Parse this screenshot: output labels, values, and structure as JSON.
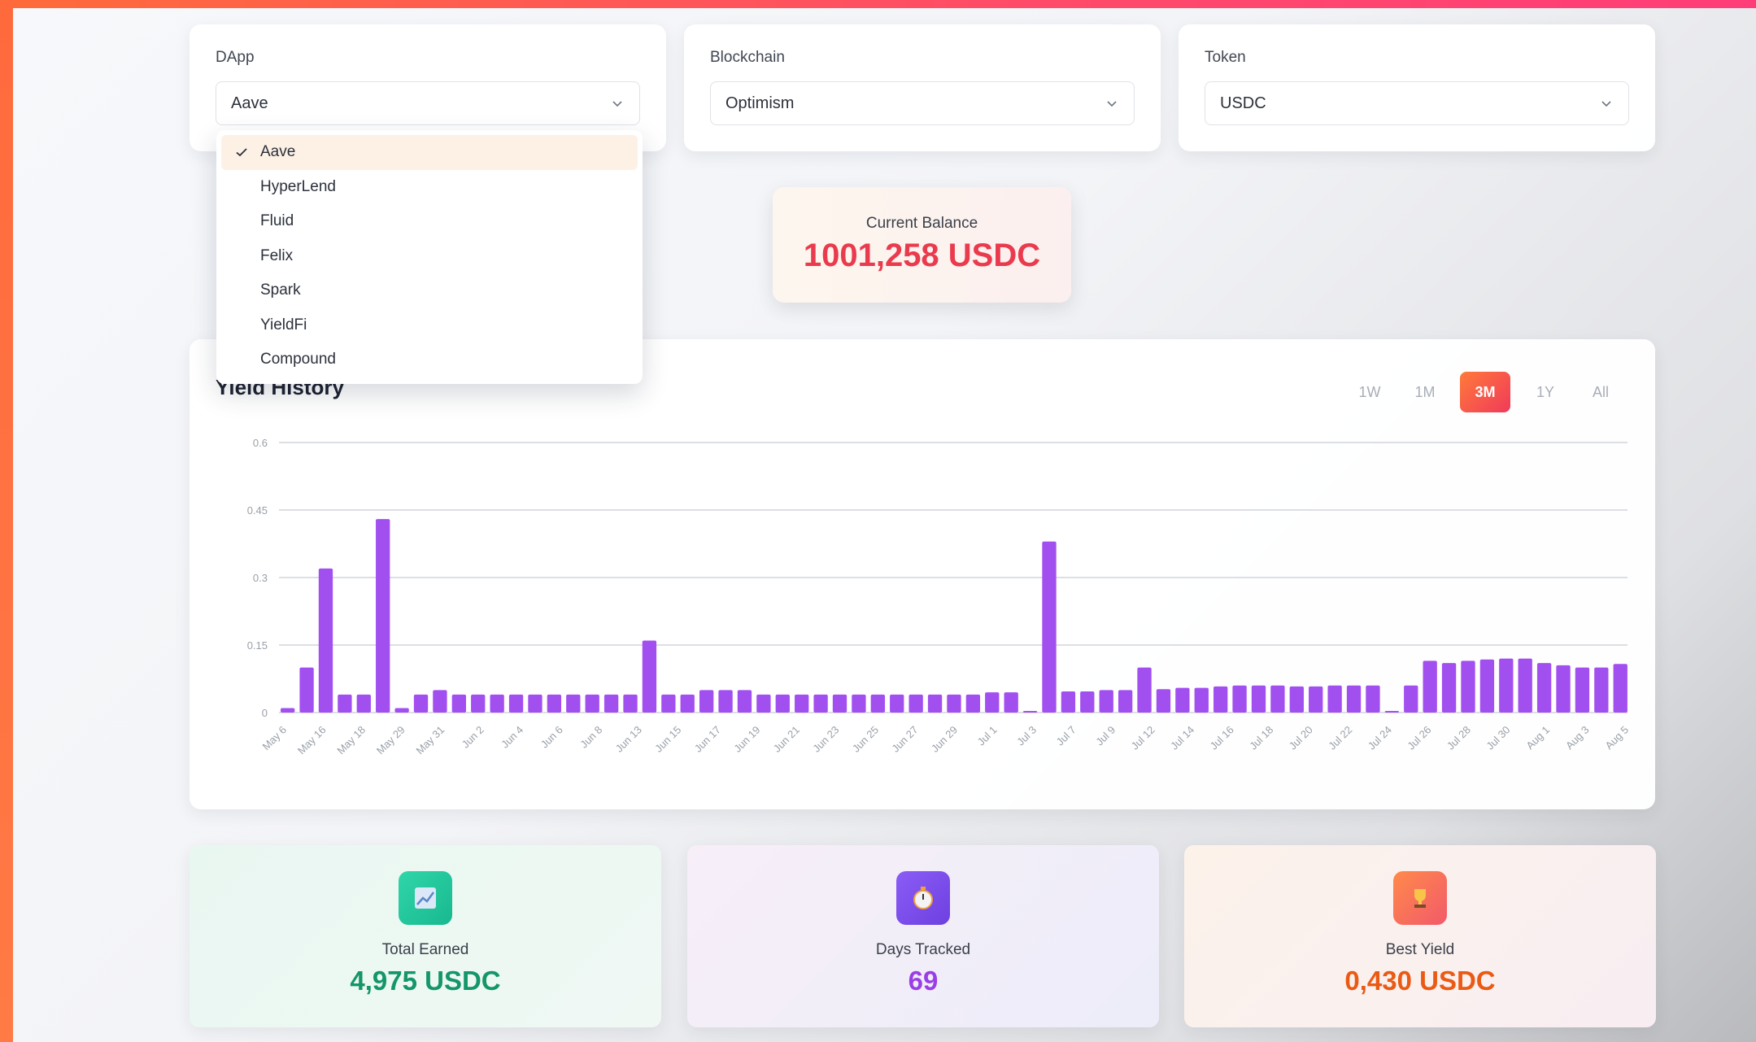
{
  "filters": {
    "dapp": {
      "label": "DApp",
      "value": "Aave"
    },
    "blockchain": {
      "label": "Blockchain",
      "value": "Optimism"
    },
    "token": {
      "label": "Token",
      "value": "USDC"
    }
  },
  "dapp_dropdown": {
    "items": [
      "Aave",
      "HyperLend",
      "Fluid",
      "Felix",
      "Spark",
      "YieldFi",
      "Compound"
    ],
    "selected": "Aave"
  },
  "balance": {
    "label": "Current Balance",
    "value": "1001,258 USDC"
  },
  "chart_panel": {
    "title": "Yield History",
    "ranges": [
      "1W",
      "1M",
      "3M",
      "1Y",
      "All"
    ],
    "active_range": "3M"
  },
  "chart_data": {
    "type": "bar",
    "ylim": [
      0,
      0.6
    ],
    "y_ticks": [
      "0",
      "0.15",
      "0.3",
      "0.45",
      "0.6"
    ],
    "x_tick_labels": [
      "May 6",
      "May 16",
      "May 18",
      "May 29",
      "May 31",
      "Jun 2",
      "Jun 4",
      "Jun 6",
      "Jun 8",
      "Jun 13",
      "Jun 15",
      "Jun 17",
      "Jun 19",
      "Jun 21",
      "Jun 23",
      "Jun 25",
      "Jun 27",
      "Jun 29",
      "Jul 1",
      "Jul 3",
      "Jul 7",
      "Jul 9",
      "Jul 12",
      "Jul 14",
      "Jul 16",
      "Jul 18",
      "Jul 20",
      "Jul 22",
      "Jul 24",
      "Jul 26",
      "Jul 28",
      "Jul 30",
      "Aug 1",
      "Aug 3",
      "Aug 5"
    ],
    "values": [
      0.01,
      0.1,
      0.32,
      0.04,
      0.04,
      0.43,
      0.01,
      0.04,
      0.05,
      0.04,
      0.04,
      0.04,
      0.04,
      0.04,
      0.04,
      0.04,
      0.04,
      0.04,
      0.04,
      0.16,
      0.04,
      0.04,
      0.05,
      0.05,
      0.05,
      0.04,
      0.04,
      0.04,
      0.04,
      0.04,
      0.04,
      0.04,
      0.04,
      0.04,
      0.04,
      0.04,
      0.04,
      0.045,
      0.045,
      0.0,
      0.38,
      0.047,
      0.047,
      0.05,
      0.05,
      0.1,
      0.052,
      0.055,
      0.055,
      0.058,
      0.06,
      0.06,
      0.06,
      0.058,
      0.058,
      0.06,
      0.06,
      0.06,
      0.0,
      0.06,
      0.115,
      0.11,
      0.115,
      0.118,
      0.12,
      0.12,
      0.11,
      0.105,
      0.1,
      0.1,
      0.108
    ],
    "bar_color": "#a24ff0",
    "grid": true
  },
  "stats": [
    {
      "label": "Total Earned",
      "value": "4,975 USDC",
      "icon": "chart-up-icon",
      "color": "#14966a"
    },
    {
      "label": "Days Tracked",
      "value": "69",
      "icon": "stopwatch-icon",
      "color": "#9a3fe6"
    },
    {
      "label": "Best Yield",
      "value": "0,430 USDC",
      "icon": "trophy-icon",
      "color": "#ea5a14"
    }
  ]
}
